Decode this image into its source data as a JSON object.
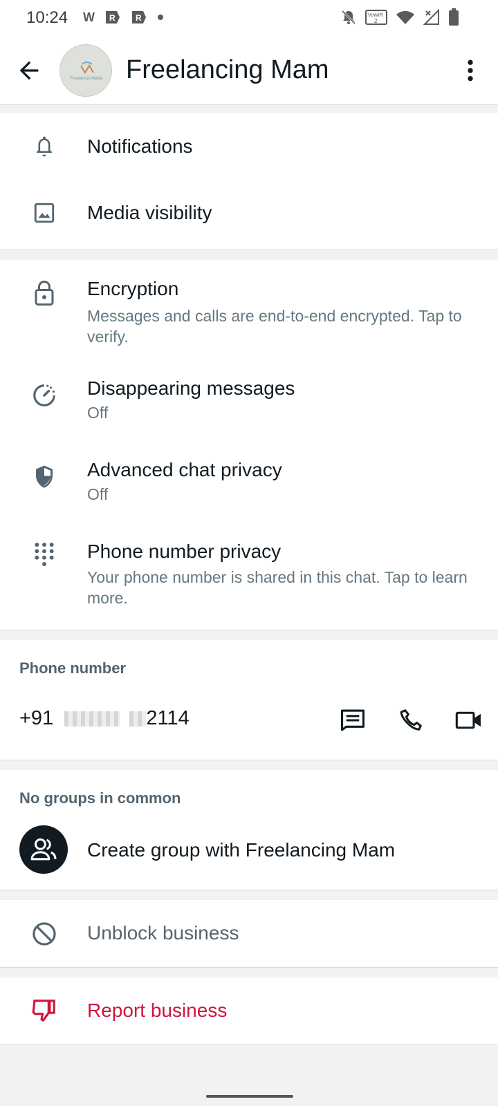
{
  "status_bar": {
    "time": "10:24",
    "left_icons": [
      "w-icon",
      "r-app-icon",
      "r-app-icon",
      "dot-icon"
    ],
    "right_icons": [
      "bell-off-icon",
      "vowifi-icon",
      "wifi-icon",
      "signal-icon",
      "battery-icon"
    ],
    "vowifi_text": "VoWiFi"
  },
  "header": {
    "title": "Freelancing Mam",
    "avatar_text": "Freelancer Media"
  },
  "settings_group_1": {
    "notifications": "Notifications",
    "media_visibility": "Media visibility"
  },
  "privacy_group": {
    "encryption": {
      "label": "Encryption",
      "sub": "Messages and calls are end-to-end encrypted. Tap to verify."
    },
    "disappearing": {
      "label": "Disappearing messages",
      "sub": "Off"
    },
    "advanced_privacy": {
      "label": "Advanced chat privacy",
      "sub": "Off"
    },
    "phone_privacy": {
      "label": "Phone number privacy",
      "sub": "Your phone number is shared in this chat. Tap to learn more."
    }
  },
  "phone_section": {
    "header": "Phone number",
    "prefix": "+91",
    "suffix": "2114"
  },
  "groups_section": {
    "header": "No groups in common",
    "create_group": "Create group with Freelancing Mam"
  },
  "actions": {
    "unblock": "Unblock business",
    "report": "Report business"
  },
  "colors": {
    "danger": "#d0153e",
    "muted": "#667781",
    "text": "#111b21"
  }
}
